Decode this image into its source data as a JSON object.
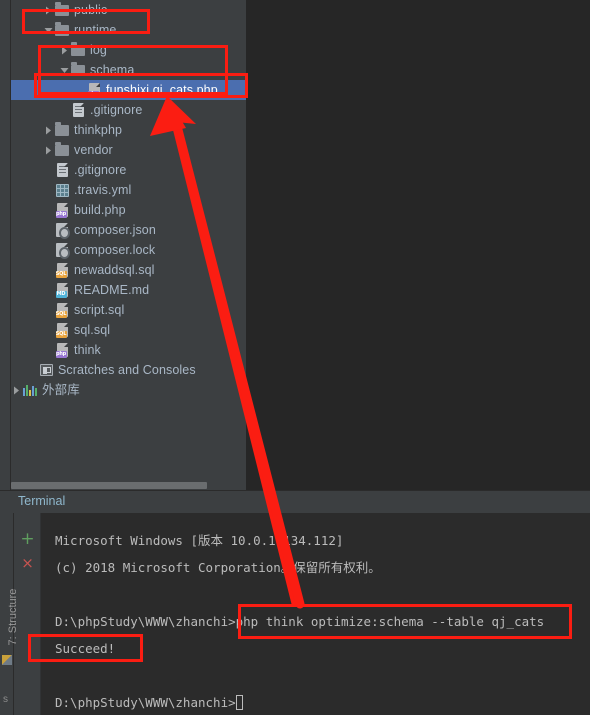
{
  "ide": {
    "project_tree": {
      "name": "project-tree",
      "items": [
        {
          "label": "public",
          "depth": 2,
          "arrow": "collapsed",
          "icon": "folder-icon",
          "selected": false
        },
        {
          "label": "runtime",
          "depth": 2,
          "arrow": "expanded",
          "icon": "folder-icon",
          "selected": false
        },
        {
          "label": "log",
          "depth": 3,
          "arrow": "collapsed",
          "icon": "folder-icon",
          "selected": false
        },
        {
          "label": "schema",
          "depth": 3,
          "arrow": "expanded",
          "icon": "folder-icon",
          "selected": false
        },
        {
          "label": "funshixi.qj_cats.php",
          "depth": 4,
          "arrow": "none",
          "icon": "php-file-icon",
          "selected": true
        },
        {
          "label": ".gitignore",
          "depth": 3,
          "arrow": "none",
          "icon": "text-file-icon",
          "selected": false
        },
        {
          "label": "thinkphp",
          "depth": 2,
          "arrow": "collapsed",
          "icon": "folder-icon",
          "selected": false
        },
        {
          "label": "vendor",
          "depth": 2,
          "arrow": "collapsed",
          "icon": "folder-icon",
          "selected": false
        },
        {
          "label": ".gitignore",
          "depth": 2,
          "arrow": "none",
          "icon": "text-file-icon",
          "selected": false
        },
        {
          "label": ".travis.yml",
          "depth": 2,
          "arrow": "none",
          "icon": "yaml-file-icon",
          "selected": false
        },
        {
          "label": "build.php",
          "depth": 2,
          "arrow": "none",
          "icon": "php-file-icon",
          "selected": false
        },
        {
          "label": "composer.json",
          "depth": 2,
          "arrow": "none",
          "icon": "composer-icon",
          "selected": false
        },
        {
          "label": "composer.lock",
          "depth": 2,
          "arrow": "none",
          "icon": "composer-icon",
          "selected": false
        },
        {
          "label": "newaddsql.sql",
          "depth": 2,
          "arrow": "none",
          "icon": "sql-file-icon",
          "selected": false
        },
        {
          "label": "README.md",
          "depth": 2,
          "arrow": "none",
          "icon": "markdown-file-icon",
          "selected": false
        },
        {
          "label": "script.sql",
          "depth": 2,
          "arrow": "none",
          "icon": "sql-file-icon",
          "selected": false
        },
        {
          "label": "sql.sql",
          "depth": 2,
          "arrow": "none",
          "icon": "sql-file-icon",
          "selected": false
        },
        {
          "label": "think",
          "depth": 2,
          "arrow": "none",
          "icon": "php-file-icon",
          "selected": false
        },
        {
          "label": "Scratches and Consoles",
          "depth": 1,
          "arrow": "none",
          "icon": "scratches-icon",
          "selected": false
        },
        {
          "label": "外部库",
          "depth": 0,
          "arrow": "collapsed",
          "icon": "library-bars-icon",
          "selected": false
        }
      ]
    },
    "terminal": {
      "tab_label": "Terminal",
      "add_button_label": "+",
      "close_button_label": "×",
      "lines": [
        "Microsoft Windows [版本 10.0.17134.112]",
        "(c) 2018 Microsoft Corporation。保留所有权利。",
        "D:\\phpStudy\\WWW\\zhanchi>php think optimize:schema --table qj_cats",
        "Succeed!",
        "D:\\phpStudy\\WWW\\zhanchi>"
      ],
      "prompt_path": "D:\\phpStudy\\WWW\\zhanchi",
      "command": "php think optimize:schema --table qj_cats",
      "result": "Succeed!"
    },
    "left_tool_strip": {
      "structure_label": "7: Structure",
      "bottom_label": "s"
    },
    "annotations": {
      "color": "#fb1d12",
      "boxes": [
        "runtime",
        "schema",
        "funshixi.qj_cats.php",
        "command",
        "Succeed!"
      ],
      "arrow": "points from the terminal command to the generated schema file"
    },
    "colors": {
      "panel_bg": "#3c3f41",
      "editor_bg": "#262626",
      "terminal_bg": "#2b2b2b",
      "selection_blue": "#4b6eaf",
      "text": "#a9b7c6",
      "tab_text": "#8fb7cc",
      "annotation_red": "#fb1d12",
      "add_green": "#5f9e5f",
      "close_red": "#c75450"
    }
  }
}
